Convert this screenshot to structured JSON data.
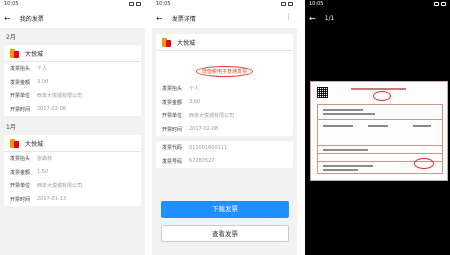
{
  "status": {
    "time1": "10:05",
    "time2": "10:05",
    "time3": "10:05"
  },
  "list_screen": {
    "title": "我的发票",
    "groups": [
      {
        "month": "2月",
        "merchant": "大悦城",
        "rows": [
          {
            "key": "发票抬头",
            "value": "个人"
          },
          {
            "key": "发票金额",
            "value": "3.00"
          },
          {
            "key": "开票单位",
            "value": "西单大悦城有限公司"
          },
          {
            "key": "开票时间",
            "value": "2017-02-08"
          }
        ]
      },
      {
        "month": "1月",
        "merchant": "大悦城",
        "rows": [
          {
            "key": "发票抬头",
            "value": "张森林"
          },
          {
            "key": "发票金额",
            "value": "1.50"
          },
          {
            "key": "开票单位",
            "value": "西单大悦城有限公司"
          },
          {
            "key": "开票时间",
            "value": "2017-01-13"
          }
        ]
      }
    ]
  },
  "detail_screen": {
    "title": "发票详情",
    "merchant": "大悦城",
    "stamp_text": "增值税电子普通发票",
    "rows": [
      {
        "key": "发票抬头",
        "value": "个人"
      },
      {
        "key": "发票金额",
        "value": "3.00"
      },
      {
        "key": "开票单位",
        "value": "西单大悦城有限公司"
      },
      {
        "key": "开票时间",
        "value": "2017-02-08"
      }
    ],
    "code_rows": [
      {
        "key": "发票代码",
        "value": "011001600111"
      },
      {
        "key": "发票号码",
        "value": "67280527"
      }
    ],
    "download_label": "下载发票",
    "view_label": "查看发票"
  },
  "viewer_screen": {
    "page_indicator": "1/1"
  },
  "colors": {
    "accent": "#1e90ff",
    "stamp": "#d9462c"
  },
  "icons": [
    "back-arrow-icon",
    "more-vertical-icon",
    "wifi-icon",
    "battery-icon"
  ]
}
